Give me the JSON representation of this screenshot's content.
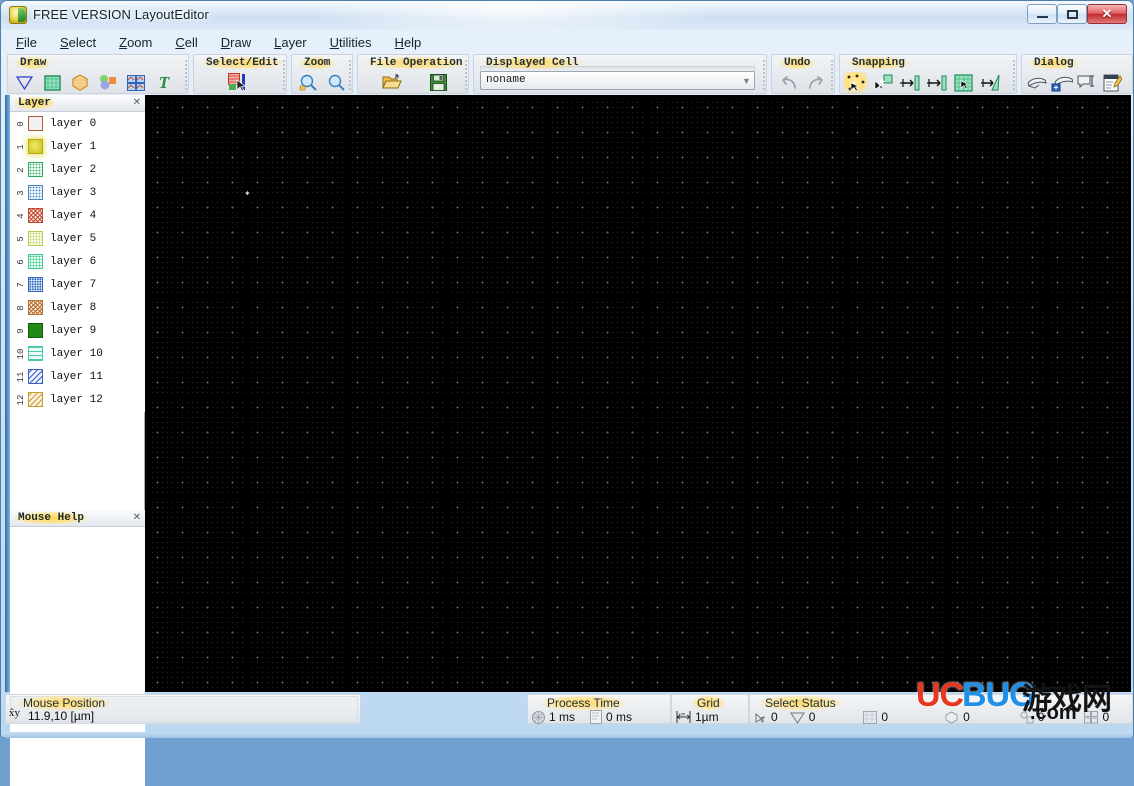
{
  "window": {
    "title": "FREE VERSION LayoutEditor",
    "app_icon": "layouteditor-icon",
    "minimize_label": "–",
    "maximize_label": "□",
    "close_label": "✕"
  },
  "menubar": {
    "items": [
      {
        "label": "File",
        "accel": "F"
      },
      {
        "label": "Select",
        "accel": "S"
      },
      {
        "label": "Zoom",
        "accel": "Z"
      },
      {
        "label": "Cell",
        "accel": "C"
      },
      {
        "label": "Draw",
        "accel": "D"
      },
      {
        "label": "Layer",
        "accel": "L"
      },
      {
        "label": "Utilities",
        "accel": "U"
      },
      {
        "label": "Help",
        "accel": "H"
      }
    ]
  },
  "toolbar": {
    "groups": [
      {
        "title": "Draw",
        "buttons": [
          {
            "icon": "polygon-icon"
          },
          {
            "icon": "box-icon"
          },
          {
            "icon": "circle-icon"
          },
          {
            "icon": "path-icon"
          },
          {
            "icon": "reference-icon"
          },
          {
            "icon": "text-icon"
          }
        ]
      },
      {
        "title": "Select/Edit",
        "buttons": [
          {
            "icon": "select-edit-icon",
            "selected": true
          }
        ]
      },
      {
        "title": "Zoom",
        "buttons": [
          {
            "icon": "zoom-fit-icon"
          },
          {
            "icon": "zoom-in-icon"
          }
        ]
      },
      {
        "title": "File Operation",
        "buttons": [
          {
            "icon": "open-folder-icon"
          },
          {
            "icon": "save-disk-icon"
          }
        ]
      },
      {
        "title": "Undo",
        "buttons": [
          {
            "icon": "undo-icon"
          },
          {
            "icon": "redo-icon"
          }
        ]
      },
      {
        "title": "Snapping",
        "buttons": [
          {
            "icon": "snap-grid-icon",
            "selected": true
          },
          {
            "icon": "snap-point-icon"
          },
          {
            "icon": "snap-edge-icon"
          },
          {
            "icon": "snap-midpoint-icon"
          },
          {
            "icon": "snap-area-icon"
          },
          {
            "icon": "snap-angle-icon"
          }
        ]
      },
      {
        "title": "Dialog",
        "buttons": [
          {
            "icon": "drc-icon"
          },
          {
            "icon": "drc-settings-icon"
          },
          {
            "icon": "measure-icon"
          },
          {
            "icon": "macro-editor-icon"
          }
        ]
      }
    ],
    "displayed_cell": {
      "title": "Displayed Cell",
      "value": "noname",
      "placeholder": "noname",
      "dropdown_icon": "chevron-down-icon"
    }
  },
  "left_dock": {
    "layer_panel": {
      "title": "Layer",
      "close_icon": "close-icon",
      "layers": [
        {
          "num": "0",
          "name": "layer 0",
          "color": "#b05a3c",
          "fill": "none"
        },
        {
          "num": "1",
          "name": "layer 1",
          "color": "#c9c019",
          "fill": "solid-soft"
        },
        {
          "num": "2",
          "name": "layer 2",
          "color": "#2fa85e",
          "fill": "dots"
        },
        {
          "num": "3",
          "name": "layer 3",
          "color": "#4a84bd",
          "fill": "dots"
        },
        {
          "num": "4",
          "name": "layer 4",
          "color": "#c24a2f",
          "fill": "cross"
        },
        {
          "num": "5",
          "name": "layer 5",
          "color": "#b5cf4a",
          "fill": "dots"
        },
        {
          "num": "6",
          "name": "layer 6",
          "color": "#3fc98c",
          "fill": "dots"
        },
        {
          "num": "7",
          "name": "layer 7",
          "color": "#2f64bd",
          "fill": "dense-dots"
        },
        {
          "num": "8",
          "name": "layer 8",
          "color": "#b5702f",
          "fill": "cross"
        },
        {
          "num": "9",
          "name": "layer 9",
          "color": "#1f8a14",
          "fill": "solid"
        },
        {
          "num": "10",
          "name": "layer 10",
          "color": "#4fc9ab",
          "fill": "hlines"
        },
        {
          "num": "11",
          "name": "layer 11",
          "color": "#3a5fc9",
          "fill": "dlines"
        },
        {
          "num": "12",
          "name": "layer 12",
          "color": "#c99a2f",
          "fill": "dlines"
        }
      ]
    },
    "mouse_help_panel": {
      "title": "Mouse Help",
      "close_icon": "close-icon",
      "body": ""
    }
  },
  "canvas": {
    "background": "#000000",
    "grid_visible": true,
    "cursor_glyph": "✦"
  },
  "statusbar": {
    "mouse_position": {
      "title": "Mouse Position",
      "axis_label": "x y",
      "value": "11.9,10 [µm]"
    },
    "process_time": {
      "title": "Process Time",
      "items": [
        {
          "icon": "render-time-icon",
          "value": "1 ms"
        },
        {
          "icon": "file-time-icon",
          "value": "0 ms"
        }
      ]
    },
    "grid": {
      "title": "Grid",
      "icon": "grid-size-icon",
      "value": "1µm"
    },
    "select_status": {
      "title": "Select Status",
      "items": [
        {
          "icon": "point-count-icon",
          "value": "0"
        },
        {
          "icon": "polygon-count-icon",
          "value": "0"
        },
        {
          "icon": "box-count-icon",
          "value": "0"
        },
        {
          "icon": "circle-count-icon",
          "value": "0"
        },
        {
          "icon": "path-count-icon",
          "value": "0"
        },
        {
          "icon": "ref-count-icon",
          "value": "0"
        }
      ]
    }
  },
  "watermark": {
    "uc": "UC",
    "bug": "BUG",
    "chinese": "游戏网",
    "dotcom": ".com",
    "color_uc": "#e8371f",
    "color_bug": "#1f8fe8"
  }
}
